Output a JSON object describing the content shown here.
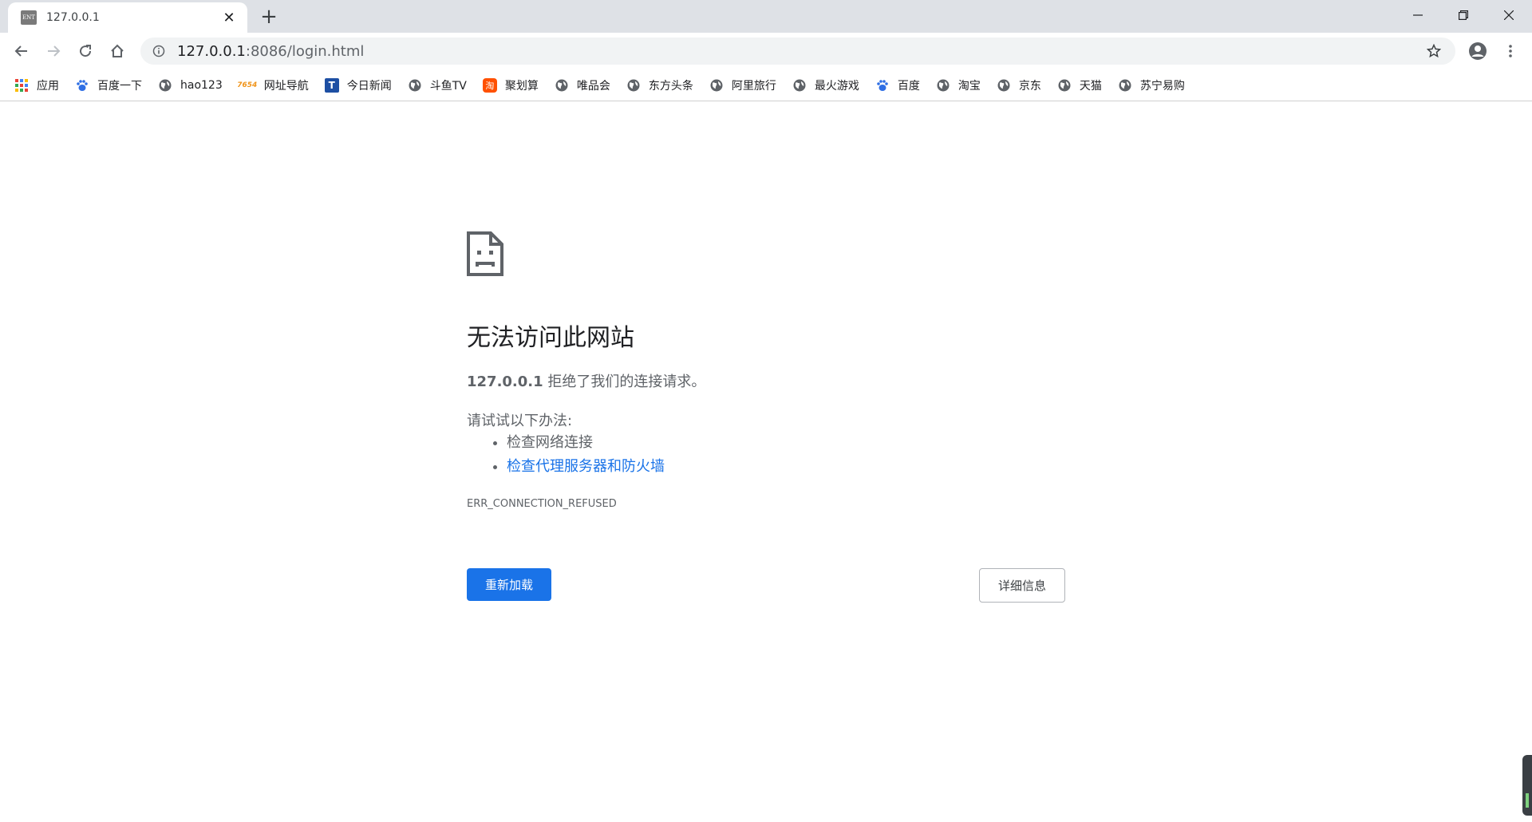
{
  "tab": {
    "favicon_text": "ENT",
    "title": "127.0.0.1",
    "close_glyph": "✕",
    "newtab_glyph": "+"
  },
  "window": {
    "minimize_glyph": "—",
    "restore_glyph": "❐",
    "close_glyph": "✕"
  },
  "omnibox": {
    "url_host": "127.0.0.1",
    "url_rest": ":8086/login.html"
  },
  "bookmarks": [
    {
      "label": "应用",
      "icon": "apps-grid-icon"
    },
    {
      "label": "百度一下",
      "icon": "baidu-paw-icon"
    },
    {
      "label": "hao123",
      "icon": "globe-icon"
    },
    {
      "label": "网址导航",
      "icon": "7654-icon",
      "icon_text": "7654"
    },
    {
      "label": "今日新闻",
      "icon": "news-t-icon",
      "icon_text": "T"
    },
    {
      "label": "斗鱼TV",
      "icon": "globe-icon"
    },
    {
      "label": "聚划算",
      "icon": "taobao-icon",
      "icon_text": "淘"
    },
    {
      "label": "唯品会",
      "icon": "globe-icon"
    },
    {
      "label": "东方头条",
      "icon": "globe-icon"
    },
    {
      "label": "阿里旅行",
      "icon": "globe-icon"
    },
    {
      "label": "最火游戏",
      "icon": "globe-icon"
    },
    {
      "label": "百度",
      "icon": "baidu-paw-icon"
    },
    {
      "label": "淘宝",
      "icon": "globe-icon"
    },
    {
      "label": "京东",
      "icon": "globe-icon"
    },
    {
      "label": "天猫",
      "icon": "globe-icon"
    },
    {
      "label": "苏宁易购",
      "icon": "globe-icon"
    }
  ],
  "error": {
    "title": "无法访问此网站",
    "host": "127.0.0.1",
    "desc_rest": " 拒绝了我们的连接请求。",
    "try_label": "请试试以下办法:",
    "suggestions": [
      "检查网络连接",
      "检查代理服务器和防火墙"
    ],
    "code": "ERR_CONNECTION_REFUSED",
    "reload_label": "重新加载",
    "details_label": "详细信息"
  },
  "colors": {
    "accent": "#1a73e8",
    "tabstrip_bg": "#dee1e6",
    "omnibox_bg": "#f1f3f4"
  }
}
